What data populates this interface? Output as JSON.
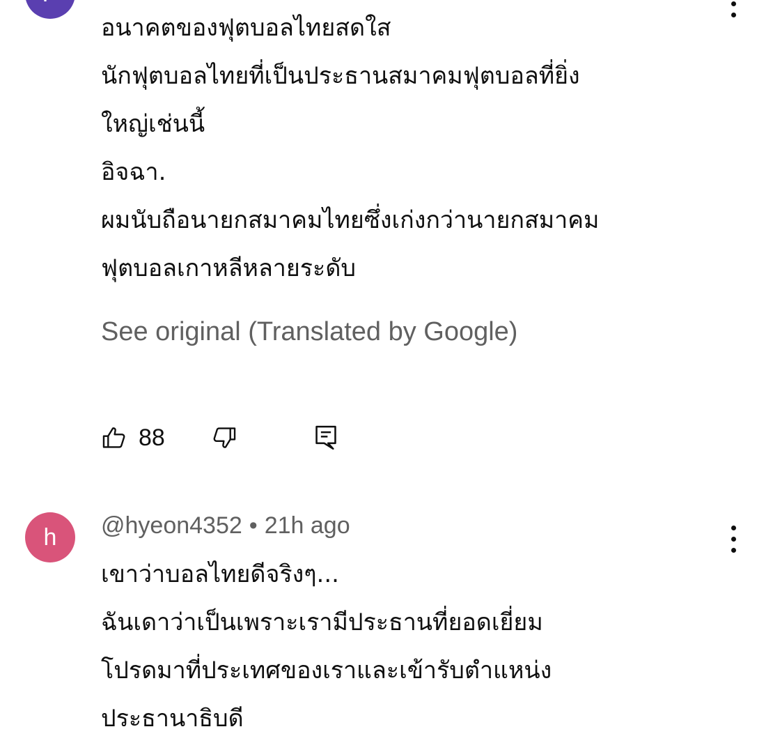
{
  "comments": [
    {
      "avatar_initial": "P",
      "avatar_color": "#5a3fb0",
      "lines": [
        "อนาคตของฟุตบอลไทยสดใส",
        "นักฟุตบอลไทยที่เป็นประธานสมาคมฟุตบอลที่ยิ่ง",
        "ใหญ่เช่นนี้",
        "อิจฉา.",
        "ผมนับถือนายกสมาคมไทยซึ่งเก่งกว่านายกสมาคม",
        "ฟุตบอลเกาหลีหลายระดับ"
      ],
      "translate_link": "See original (Translated by Google)",
      "like_count": "88"
    },
    {
      "avatar_initial": "h",
      "avatar_color": "#d9547a",
      "author": "@hyeon4352",
      "separator": "•",
      "time": "21h ago",
      "lines": [
        "เขาว่าบอลไทยดีจริงๆ...",
        "ฉันเดาว่าเป็นเพราะเรามีประธานที่ยอดเยี่ยม",
        "โปรดมาที่ประเทศของเราและเข้ารับตำแหน่ง",
        "ประธานาธิบดี"
      ]
    }
  ],
  "icons": {
    "like": "thumbs-up-icon",
    "dislike": "thumbs-down-icon",
    "reply": "comment-reply-icon",
    "more": "more-vertical-icon"
  }
}
